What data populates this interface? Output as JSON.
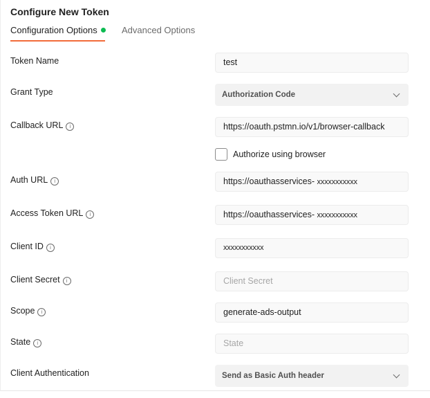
{
  "header": {
    "title": "Configure New Token"
  },
  "tabs": [
    {
      "label": "Configuration Options",
      "active": true,
      "status_dot_color": "#0cbb52"
    },
    {
      "label": "Advanced Options",
      "active": false
    }
  ],
  "accent_color": "#f26b3a",
  "form": {
    "token_name": {
      "label": "Token Name",
      "value": "test"
    },
    "grant_type": {
      "label": "Grant Type",
      "value": "Authorization Code"
    },
    "callback_url": {
      "label": "Callback URL",
      "value": "https://oauth.pstmn.io/v1/browser-callback"
    },
    "authorize_browser": {
      "label": "Authorize using browser",
      "checked": false
    },
    "auth_url": {
      "label": "Auth URL",
      "value_prefix": "https://oauthasservices-",
      "value_masked": "xxxxxxxxxxx"
    },
    "access_token_url": {
      "label": "Access Token URL",
      "value_prefix": "https://oauthasservices-",
      "value_masked": "xxxxxxxxxxx"
    },
    "client_id": {
      "label": "Client ID",
      "value": "xxxxxxxxxxx"
    },
    "client_secret": {
      "label": "Client Secret",
      "value": "",
      "placeholder": "Client Secret"
    },
    "scope": {
      "label": "Scope",
      "value": "generate-ads-output"
    },
    "state": {
      "label": "State",
      "value": "",
      "placeholder": "State"
    },
    "client_authentication": {
      "label": "Client Authentication",
      "value": "Send as Basic Auth header"
    }
  },
  "icons": {
    "info": "info-circle-icon",
    "chevron": "chevron-down-icon",
    "info_glyph": "i"
  }
}
